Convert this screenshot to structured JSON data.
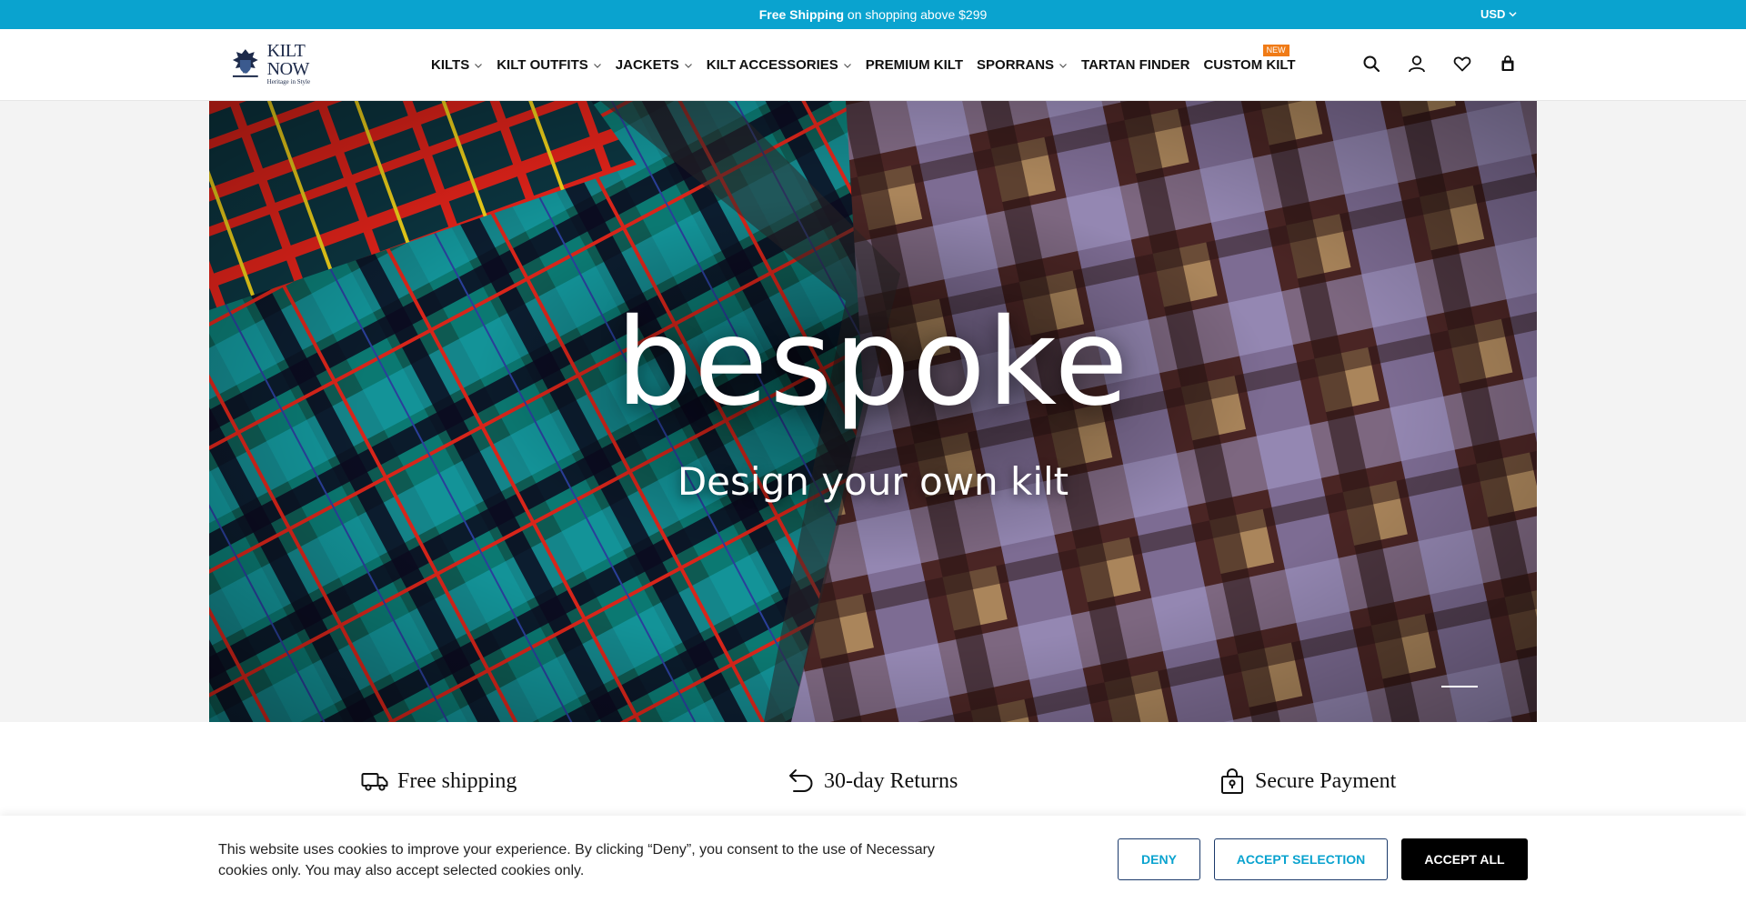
{
  "announcement": {
    "bold": "Free Shipping",
    "text": " on shopping above $299",
    "currency": "USD"
  },
  "header": {
    "logo_name": "KILT NOW",
    "logo_tagline": "Heritage in Style",
    "nav": [
      {
        "label": "KILTS",
        "dropdown": true
      },
      {
        "label": "KILT OUTFITS",
        "dropdown": true
      },
      {
        "label": "JACKETS",
        "dropdown": true
      },
      {
        "label": "KILT ACCESSORIES",
        "dropdown": true
      },
      {
        "label": "PREMIUM KILT",
        "dropdown": false
      },
      {
        "label": "SPORRANS",
        "dropdown": true
      },
      {
        "label": "TARTAN FINDER",
        "dropdown": false
      },
      {
        "label": "CUSTOM KILT",
        "dropdown": false,
        "badge": "NEW"
      }
    ],
    "icons": [
      "search-icon",
      "account-icon",
      "wishlist-icon",
      "cart-icon"
    ]
  },
  "hero": {
    "title": "bespoke",
    "subtitle": "Design your own kilt",
    "slide_count": 1,
    "active_slide": 1
  },
  "features": [
    {
      "icon": "truck-icon",
      "label": "Free shipping"
    },
    {
      "icon": "return-icon",
      "label": "30-day Returns"
    },
    {
      "icon": "lock-bag-icon",
      "label": "Secure Payment"
    }
  ],
  "cookie": {
    "text": "This website uses cookies to improve your experience. By clicking “Deny”, you consent to the use of Necessary cookies only. You may also accept selected cookies only.",
    "deny": "DENY",
    "accept_selection": "ACCEPT SELECTION",
    "accept_all": "ACCEPT ALL"
  },
  "colors": {
    "announcement_bg": "#0aa3cf",
    "badge": "#f07b16",
    "accent_text": "#0aa3cf",
    "button_dark": "#000000"
  }
}
